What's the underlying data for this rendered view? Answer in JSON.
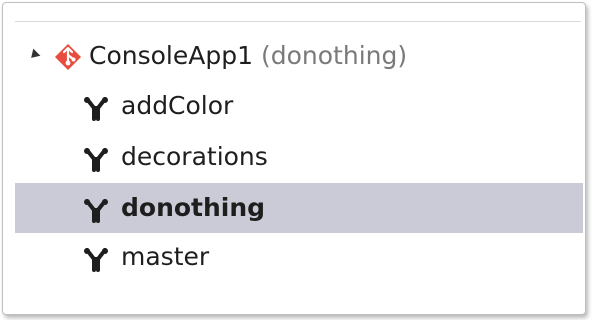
{
  "repository": {
    "name": "ConsoleApp1",
    "current_branch_label": "(donothing)",
    "icon": "git-repo-icon",
    "accent_color": "#e74c3c"
  },
  "branches": [
    {
      "label": "addColor",
      "icon": "branch-icon",
      "selected": false
    },
    {
      "label": "decorations",
      "icon": "branch-icon",
      "selected": false
    },
    {
      "label": "donothing",
      "icon": "branch-icon",
      "selected": true
    },
    {
      "label": "master",
      "icon": "branch-icon",
      "selected": false
    }
  ],
  "colors": {
    "selection_background": "#cbcbd8",
    "text": "#1e1e1e",
    "muted_text": "#7a7a7a"
  }
}
